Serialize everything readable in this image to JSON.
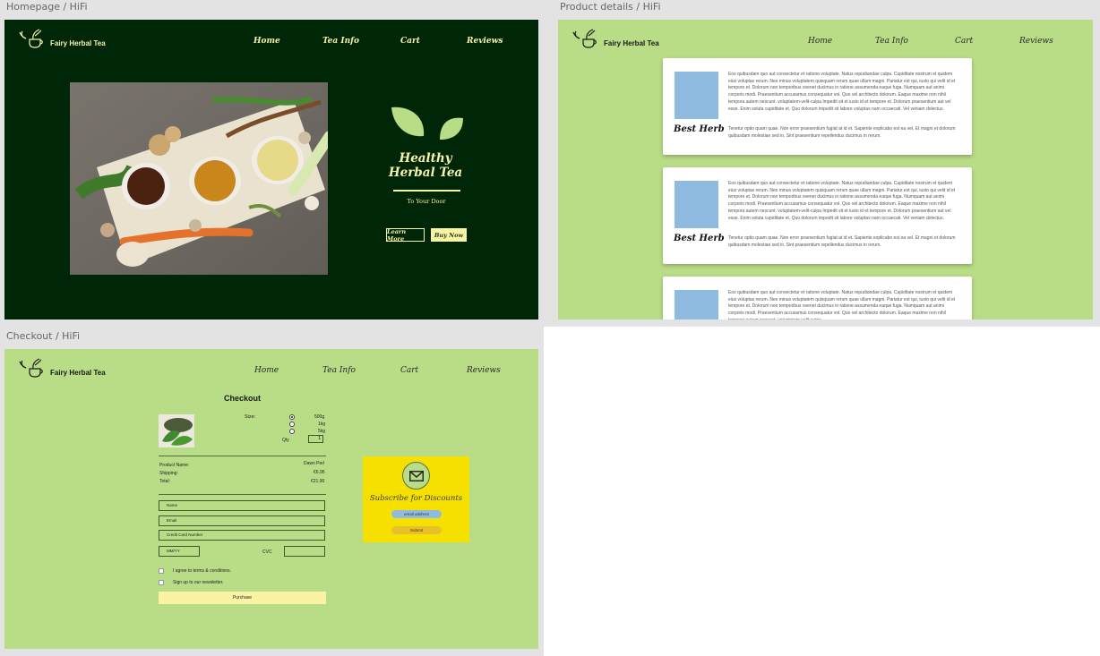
{
  "frames": {
    "home_label": "Homepage / HiFi",
    "product_label": "Product details / HiFi",
    "checkout_label": "Checkout  / HiFi"
  },
  "brand": {
    "name": "Fairy Herbal Tea"
  },
  "nav": {
    "home": "Home",
    "tea_info": "Tea Info",
    "cart": "Cart",
    "reviews": "Reviews"
  },
  "home": {
    "hero_title_1": "Healthy",
    "hero_title_2": "Herbal Tea",
    "hero_subtitle": "To Your Door",
    "learn_more": "Learn More",
    "buy_now": "Buy Now"
  },
  "product": {
    "cards": [
      {
        "name": "Best Herb",
        "body": "Eos quibusdam quo aut consectetur et ratione voluptate. Natus repudiandae culpa. Cupiditate nostrum et quidem eius voluptas rerum. Nes minus voluptatem quisquam rerum quae ullam magni. Pariatur est qui, iusto qui velit id et tempore et. Dolorum non temporibus ovenet ducimus in ratione assumenda eaque fuga. Numquam aut animi corporis modi. Praesentium accusamus consequatur vol. Quo vel architecto dolorum. Eaque maxime non nihil tempora autem nescunt. voluptatem-velit-culpa Impedit sit et iusto id et tempore et. Dolorum praesentium aut vel esse. Enim soluta cupiditate et. Quo dolorum impedit sit labore voluptas nam occaecati. Vel veniam dolectus.",
        "body2": "Tenetur optio quam quae. Non error praesentium fugiat at id et. Sapiente explicabo est ea vel. Et magni et dolorum quibusdam molestiae sed in. Sint praesentium repellendus ducimus in rerum."
      },
      {
        "name": "Best Herb",
        "body": "Eos quibusdam quo aut consectetur et ratione voluptate. Natus repudiandae culpa. Cupiditate nostrum et quidem eius voluptas rerum. Nes minus voluptatem quisquam rerum quae ullam magni. Pariatur est qui, iusto qui velit id et tempore et. Dolorum non temporibus ovenet ducimus in ratione assumenda eaque fuga. Numquam aut animi corporis modi. Praesentium accusamus consequatur vol. Quo vel architecto dolorum. Eaque maxime non nihil tempora autem nescunt. voluptatem-velit-culpa Impedit sit et iusto id et tempore et. Dolorum praesentium aut vel esse. Enim soluta cupiditate et. Quo dolorum impedit sit labore voluptas nam occaecati. Vel veniam dolectus.",
        "body2": "Tenetur optio quam quae. Non error praesentium fugiat at id et. Sapiente explicabo est ea vel. Et magni et dolorum quibusdam molestiae sed in. Sint praesentium repellendus ducimus in rerum."
      },
      {
        "name": "",
        "body": "Eos quibusdam quo aut consectetur et ratione voluptate. Natus repudiandae culpa. Cupiditate nostrum et quidem eius voluptas rerum. Nes minus voluptatem quisquam rerum quae ullam magni. Pariatur est qui, iusto qui velit id et tempore et. Dolorum non temporibus ovenet ducimus in ratione assumenda eaque fuga. Numquam aut animi corporis modi. Praesentium accusamus consequatur vol. Quo vel architecto dolorum. Eaque maxime non nihil tempora autem nescunt. voluptatem-velit-culpa",
        "body2": ""
      }
    ]
  },
  "checkout": {
    "title": "Checkout",
    "size_label": "Size:",
    "sizes": [
      "500g",
      "1kg",
      "5kg"
    ],
    "selected_size": "500g",
    "qty_label": "Qty",
    "qty_value": "1",
    "product_name_label": "Product Name:",
    "product_name_value": "Dawn Perl",
    "shipping_label": "Shipping:",
    "shipping_value": "€6.95",
    "total_label": "Total:",
    "total_value": "€21.90",
    "field_name": "Name",
    "field_email": "Email",
    "field_card": "Credit Card Number",
    "field_expiry": "MM/YY",
    "cvc_label": "CVC",
    "terms_label": "I agree to terms & conditions.",
    "newsletter_label": "Sign up to our newsletter.",
    "purchase": "Purchase",
    "subscribe_title": "Subscribe for Discounts",
    "email_placeholder": "email address",
    "submit": "Submit"
  },
  "colors": {
    "home_bg": "#002608",
    "light_green": "#b9dc86",
    "cream": "#fbf3a4",
    "blue_placeholder": "#8fbbe1",
    "subscribe_yellow": "#f5e000"
  }
}
